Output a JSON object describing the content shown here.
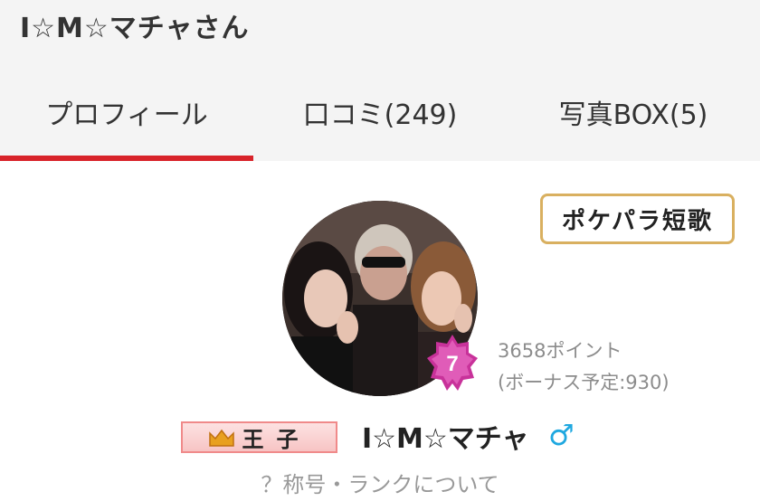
{
  "header": {
    "title": "I☆M☆マチャさん"
  },
  "tabs": [
    {
      "label": "プロフィール",
      "active": true
    },
    {
      "label": "口コミ(249)",
      "active": false
    },
    {
      "label": "写真BOX(5)",
      "active": false
    }
  ],
  "profile": {
    "tanka_button": "ポケパラ短歌",
    "rank_level": "7",
    "points": "3658ポイント",
    "bonus": "(ボーナス予定:930)",
    "rank_title": "王子",
    "username": "I☆M☆マチャ",
    "gender_symbol": "♂",
    "about_rank_link": "？称号・ランクについて"
  },
  "colors": {
    "accent": "#d8232a",
    "tanka_border": "#d9b060",
    "badge": "#c8329a",
    "gender": "#1fa8e0"
  }
}
